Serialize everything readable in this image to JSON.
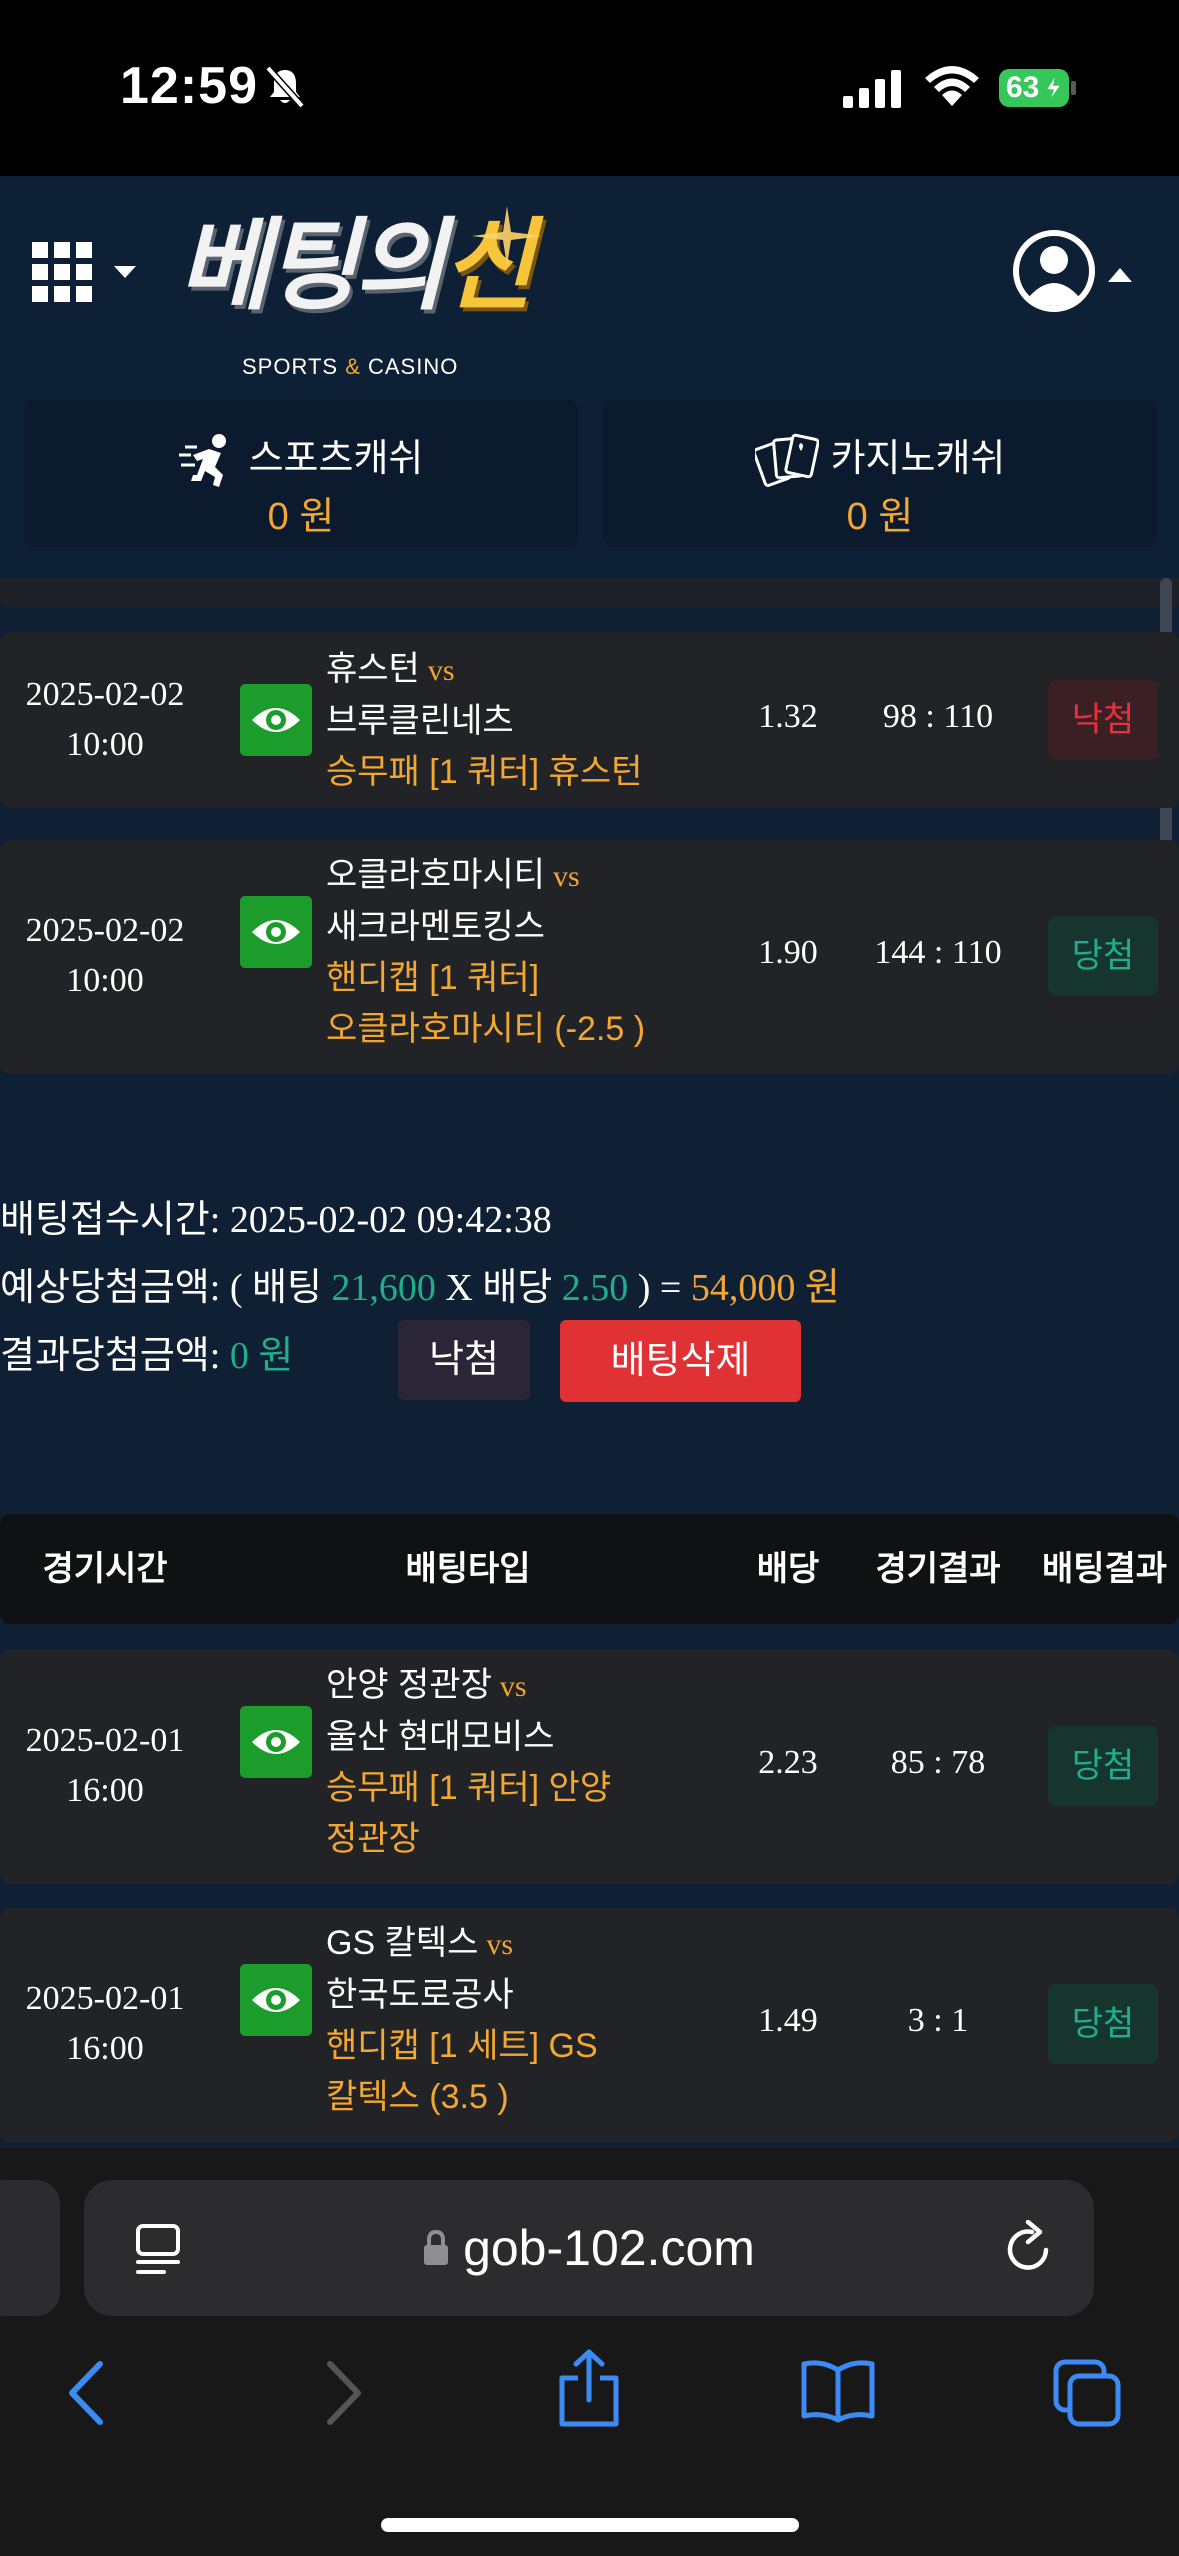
{
  "status_bar": {
    "time": "12:59",
    "battery": "63"
  },
  "header": {
    "logo_main_white": "베팅의",
    "logo_main_gold": "신",
    "logo_sub_1": "SPORTS",
    "logo_sub_amp": "&",
    "logo_sub_2": "CASINO"
  },
  "cash": {
    "sports_label": "스포츠캐쉬",
    "sports_value": "0 원",
    "casino_label": "카지노캐쉬",
    "casino_value": "0 원"
  },
  "bet_rows_top": [
    {
      "date": "2025-02-02",
      "time": "10:00",
      "home": "휴스턴",
      "vs": "vs",
      "away": "브루클린네츠",
      "type_1": "승무패 [1 쿼터] 휴스턴",
      "type_2": "",
      "odds": "1.32",
      "score": "98 : 110",
      "result": "낙첨"
    },
    {
      "date": "2025-02-02",
      "time": "10:00",
      "home": "오클라호마시티",
      "vs": "vs",
      "away": "새크라멘토킹스",
      "type_1": "핸디캡 [1 쿼터]",
      "type_2": "오클라호마시티 (-2.5 )",
      "odds": "1.90",
      "score": "144 : 110",
      "result": "당첨"
    }
  ],
  "summary": {
    "time_label": "배팅접수시간:",
    "time_value": "2025-02-02 09:42:38",
    "expected_label": "예상당첨금액:",
    "expected_open": "( 배팅",
    "bet_amount": "21,600",
    "expected_mid": "X 배당",
    "odds": "2.50",
    "expected_close": ") =",
    "expected_total": "54,000 원",
    "result_label": "결과당첨금액:",
    "result_value": "0 원",
    "lose_button": "낙첨",
    "delete_button": "배팅삭제"
  },
  "table_header": {
    "col_time": "경기시간",
    "col_type": "배팅타입",
    "col_odds": "배당",
    "col_score": "경기결과",
    "col_result": "배팅결과"
  },
  "bet_rows_bottom": [
    {
      "date": "2025-02-01",
      "time": "16:00",
      "home": "안양 정관장",
      "vs": "vs",
      "away": "울산 현대모비스",
      "type_1": "승무패 [1 쿼터] 안양",
      "type_2": "정관장",
      "odds": "2.23",
      "score": "85 : 78",
      "result": "당첨"
    },
    {
      "date": "2025-02-01",
      "time": "16:00",
      "home": "GS 칼텍스",
      "vs": "vs",
      "away": "한국도로공사",
      "type_1": "핸디캡 [1 세트] GS",
      "type_2": "칼텍스 (3.5 )",
      "odds": "1.49",
      "score": "3 : 1",
      "result": "당첨"
    }
  ],
  "safari": {
    "url": "gob-102.com"
  }
}
